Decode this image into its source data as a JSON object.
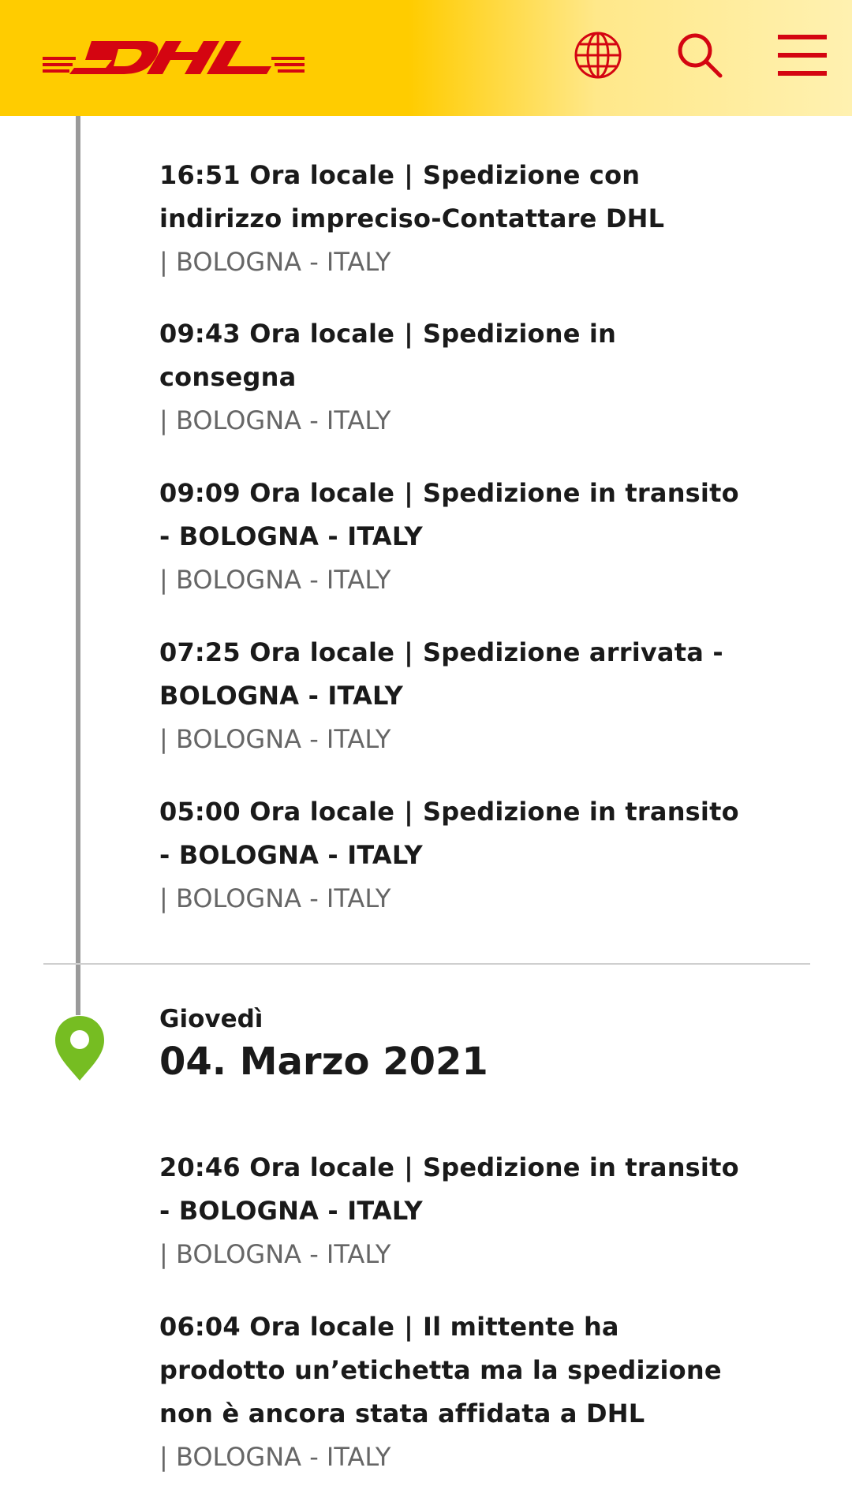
{
  "header": {
    "brand": "DHL",
    "colors": {
      "yellow": "#ffcc00",
      "red": "#d40511"
    },
    "icons": [
      "globe-icon",
      "search-icon",
      "menu-icon"
    ]
  },
  "events_day1": [
    {
      "time": "16:51 Ora locale",
      "sep": "|",
      "status": "Spedizione con indirizzo impreciso-Contattare DHL",
      "location": "| BOLOGNA - ITALY"
    },
    {
      "time": "09:43 Ora locale",
      "sep": "|",
      "status": "Spedizione in consegna",
      "location": "| BOLOGNA - ITALY"
    },
    {
      "time": "09:09 Ora locale",
      "sep": "|",
      "status": "Spedizione in transito - BOLOGNA - ITALY",
      "location": "| BOLOGNA - ITALY"
    },
    {
      "time": "07:25 Ora locale",
      "sep": "|",
      "status": "Spedizione arrivata - BOLOGNA - ITALY",
      "location": "| BOLOGNA - ITALY"
    },
    {
      "time": "05:00 Ora locale",
      "sep": "|",
      "status": "Spedizione in transito - BOLOGNA - ITALY",
      "location": "| BOLOGNA - ITALY"
    }
  ],
  "day2": {
    "weekday": "Giovedì",
    "date": "04. Marzo 2021",
    "pin_color": "#76bd22"
  },
  "events_day2": [
    {
      "time": "20:46 Ora locale",
      "sep": "|",
      "status": "Spedizione in transito - BOLOGNA - ITALY",
      "location": "| BOLOGNA - ITALY"
    },
    {
      "time": "06:04 Ora locale",
      "sep": "|",
      "status": "Il mittente ha prodotto un’etichetta ma la spedizione non è ancora stata affidata a DHL",
      "location": "| BOLOGNA - ITALY"
    }
  ]
}
